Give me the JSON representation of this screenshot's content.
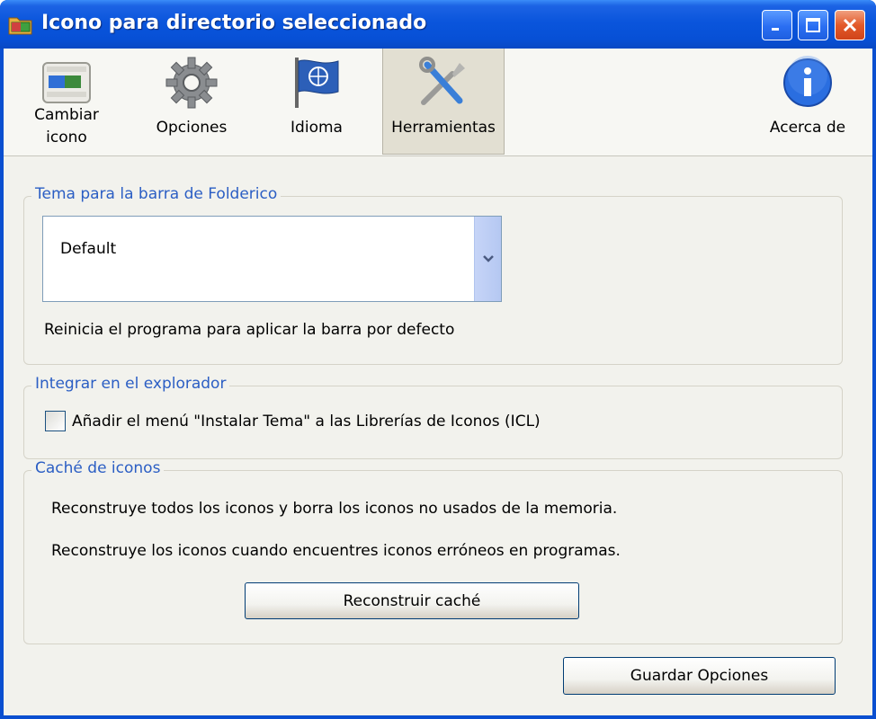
{
  "window": {
    "title": "Icono para directorio seleccionado"
  },
  "toolbar": {
    "items": [
      {
        "label": "Cambiar icono",
        "active": false
      },
      {
        "label": "Opciones",
        "active": false
      },
      {
        "label": "Idioma",
        "active": false
      },
      {
        "label": "Herramientas",
        "active": true
      },
      {
        "label": "Acerca de",
        "active": false
      }
    ],
    "cambiar_line1": "Cambiar",
    "cambiar_line2": "icono"
  },
  "theme_group": {
    "title": "Tema para la barra de Folderico",
    "selected": "Default",
    "note": "Reinicia el programa para aplicar la barra por defecto"
  },
  "explorer_group": {
    "title": "Integrar en el explorador",
    "checkbox_label": "Añadir el menú \"Instalar Tema\" a las Librerías de Iconos (ICL)",
    "checked": false
  },
  "cache_group": {
    "title": "Caché de iconos",
    "line1": "Reconstruye todos los iconos y borra los iconos no usados de la memoria.",
    "line2": "Reconstruye los iconos cuando encuentres iconos erróneos en programas.",
    "rebuild_button": "Reconstruir caché"
  },
  "footer": {
    "save_button": "Guardar Opciones"
  },
  "colors": {
    "titlebar": "#0a55dc",
    "group_title": "#2b5ec4",
    "close_button": "#e35a2a"
  }
}
